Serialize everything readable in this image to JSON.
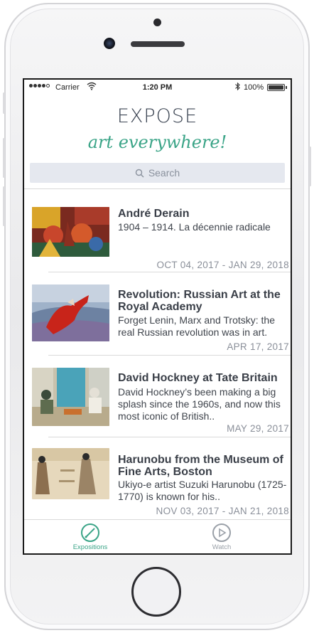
{
  "status_bar": {
    "carrier": "Carrier",
    "time": "1:20 PM",
    "battery": "100%"
  },
  "header": {
    "title": "EXPOSE",
    "tagline": "art everywhere!",
    "accent_color": "#3aa487"
  },
  "search": {
    "placeholder": "Search",
    "icon": "search-icon"
  },
  "expositions": [
    {
      "title": "André Derain",
      "description": "1904 – 1914. La décennie radicale",
      "dates": "OCT 04, 2017 - JAN 29, 2018"
    },
    {
      "title": "Revolution: Russian Art at the Royal Academy",
      "description": "Forget Lenin, Marx and Trotsky: the real Russian revolution was in art.",
      "dates": "APR 17, 2017"
    },
    {
      "title": "David Hockney at Tate Britain",
      "description": "David Hockney’s been making a big splash since the 1960s, and now this most iconic of British..",
      "dates": "MAY 29, 2017"
    },
    {
      "title": "Harunobu from the Museum of Fine Arts, Boston",
      "description": "Ukiyo-e artist Suzuki Harunobu (1725-1770) is known for his..",
      "dates": "NOV 03, 2017 - JAN 21, 2018"
    }
  ],
  "tabs": [
    {
      "label": "Expositions",
      "icon": "brush-icon",
      "active": true
    },
    {
      "label": "Watch",
      "icon": "play-icon",
      "active": false
    }
  ]
}
